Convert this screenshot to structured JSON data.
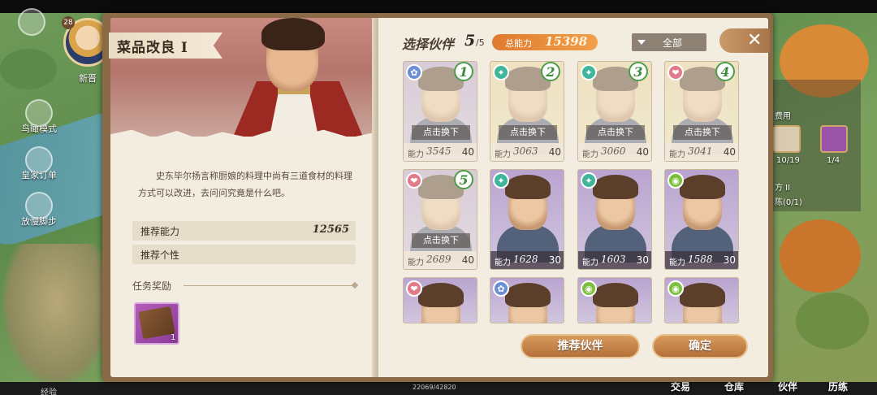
{
  "map": {
    "player_level": "28",
    "player_name": "新晋",
    "side_menu": [
      "鸟瞰模式",
      "皇家订单",
      "放慢脚步"
    ],
    "right_panel": {
      "title": "费用",
      "count_a": "10/19",
      "count_b": "1/4",
      "text_a": "方 II",
      "text_b": "陈(0/1)"
    },
    "bottom": {
      "exp_label": "经验",
      "exp_value": "22069/42820",
      "nav": [
        "交易",
        "仓库",
        "伙伴",
        "历练"
      ]
    }
  },
  "quest": {
    "title": "菜品改良 I",
    "description": "史东毕尔扬言称厨娘的料理中尚有三道食材的料理方式可以改进，去问问究竟是什么吧。",
    "recommend_power_label": "推荐能力",
    "recommend_power_value": "12565",
    "recommend_trait_label": "推荐个性",
    "reward_title": "任务奖励",
    "reward_count": "1"
  },
  "selection": {
    "label": "选择伙伴",
    "count": "5",
    "total": "/5",
    "power_label": "总能力",
    "power_value": "15398",
    "filter": "全部",
    "power_prefix": "能力",
    "swap_text": "点击换下"
  },
  "cards": [
    {
      "slot": "1",
      "power": "3545",
      "level": "40",
      "type": "sky",
      "bg": "purple",
      "selected": true
    },
    {
      "slot": "2",
      "power": "3063",
      "level": "40",
      "type": "run",
      "bg": "gold",
      "selected": true
    },
    {
      "slot": "3",
      "power": "3060",
      "level": "40",
      "type": "run",
      "bg": "gold",
      "selected": true
    },
    {
      "slot": "4",
      "power": "3041",
      "level": "40",
      "type": "heart",
      "bg": "gold",
      "selected": true
    },
    {
      "slot": "5",
      "power": "2689",
      "level": "40",
      "type": "heart",
      "bg": "purple",
      "selected": true
    },
    {
      "slot": "",
      "power": "1628",
      "level": "30",
      "type": "run",
      "bg": "purple",
      "selected": false
    },
    {
      "slot": "",
      "power": "1603",
      "level": "30",
      "type": "run",
      "bg": "purple",
      "selected": false
    },
    {
      "slot": "",
      "power": "1588",
      "level": "30",
      "type": "eye",
      "bg": "purple",
      "selected": false
    },
    {
      "slot": "",
      "power": "",
      "level": "",
      "type": "heart",
      "bg": "purple",
      "selected": false
    },
    {
      "slot": "",
      "power": "",
      "level": "",
      "type": "sky",
      "bg": "purple",
      "selected": false
    },
    {
      "slot": "",
      "power": "",
      "level": "",
      "type": "eye",
      "bg": "purple",
      "selected": false
    },
    {
      "slot": "",
      "power": "",
      "level": "",
      "type": "eye",
      "bg": "purple",
      "selected": false
    }
  ],
  "buttons": {
    "recommend": "推荐伙伴",
    "confirm": "确定"
  },
  "colors": {
    "accent_orange": "#e07a2e",
    "slot_green": "#4d9c4a",
    "type_heart": "#e07c8a",
    "type_run": "#3fb59b",
    "type_eye": "#7cbf3c",
    "type_sky": "#6b8fd6"
  }
}
